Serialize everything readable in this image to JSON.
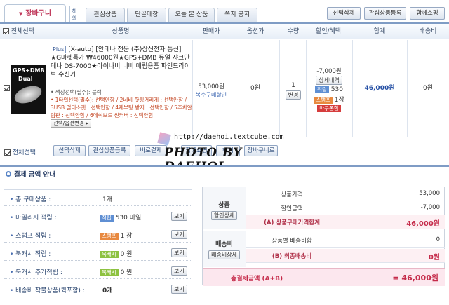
{
  "tabs": {
    "active": "장바구니",
    "side": "해외",
    "items": [
      "관심상품",
      "단골매장",
      "오늘 본 상품",
      "쪽지 공지"
    ]
  },
  "topbuttons": [
    "선택삭제",
    "관심상품등록",
    "함께쇼핑"
  ],
  "header": {
    "select_all": "전체선택",
    "columns": [
      "상품명",
      "판매가",
      "옵션가",
      "수량",
      "할인/혜택",
      "합계",
      "배송비"
    ]
  },
  "product": {
    "thumb_text": [
      "GPS+DMB",
      "Dual"
    ],
    "plus_badge": "Plus",
    "name": "[X-auto] [안테나 전문 (주)상신전자 통신] ★G마켓특가 ₩46000원★GPS+DMB 듀얼 샤크안테나 DS-7000★아이나비 네비 매립용품 파인드라이브 수신기",
    "option_lines": [
      "• 색상선택(필수): 블랙",
      "• 1타입선택(필수): 선택안함 / 2네비 핫핑거리게 : 선택안함 / 3USB 멀티소켓 : 선택안함 / 4재부팅 방지 : 선택안함 / 5주차알림판 : 선택안함 / 6데쉬보드 썬커버 : 선택안함"
    ],
    "option_button": "선택/옵션변경",
    "price": "53,000원",
    "price_link": "복수구매할인",
    "option_price": "0원",
    "qty": "1",
    "qty_button": "변경",
    "discount": "-7,000원",
    "detail_button": "상세내역",
    "mileage_badge": "적립",
    "mileage_value": "530",
    "stamp_badge": "스탬프",
    "stamp_value": "1장",
    "coupon_badge": "마구폰함",
    "total": "46,000원",
    "shipping": "0원"
  },
  "actions": {
    "select_all": "전체선택",
    "buttons": [
      "선택삭제",
      "관심상품등록",
      "바로결제",
      "함께쇼핑",
      "해외",
      "장바구니로"
    ]
  },
  "watermark": {
    "url": "http://daehoi.textcube.com",
    "big": "PHOTO BY DAEHOI"
  },
  "payment": {
    "title": "결제 금액 안내",
    "left": [
      {
        "label": "총 구매상품 :",
        "value": "1개",
        "badge": "",
        "btn": ""
      },
      {
        "label": "마일리지 적립 :",
        "value": "530 마일",
        "badge": "적립",
        "btn": "보기"
      },
      {
        "label": "스탬프 적립 :",
        "value": "1 장",
        "badge": "스탬프",
        "btn": "보기"
      },
      {
        "label": "북캐시 적립 :",
        "value": "0 원",
        "badge": "북캐시",
        "btn": "보기"
      },
      {
        "label": "북캐시 추가적립 :",
        "value": "0 원",
        "badge": "북캐시",
        "btn": "보기"
      },
      {
        "label": "배송비 착불상품(퀵포함) :",
        "value": "0개",
        "badge": "",
        "btn": "보기"
      }
    ],
    "right": {
      "product_cat": "상품",
      "product_btn": "할인상세",
      "rows1": [
        {
          "k": "상품가격",
          "v": "53,000"
        },
        {
          "k": "할인금액",
          "v": "-7,000"
        },
        {
          "k": "(A) 상품구매가격합계",
          "v": "46,000원"
        }
      ],
      "ship_cat": "배송비",
      "ship_btn": "배송비상세",
      "rows2": [
        {
          "k": "상품별 배송비합",
          "v": "0"
        },
        {
          "k": "(B) 최종배송비",
          "v": "0원"
        }
      ],
      "grand_label": "총결제금액 (A+B)",
      "grand_value": "= 46,000원"
    }
  },
  "colors": {
    "accent": "#c52b4a",
    "blue": "#244fa4",
    "header": "#7f9cc5"
  }
}
